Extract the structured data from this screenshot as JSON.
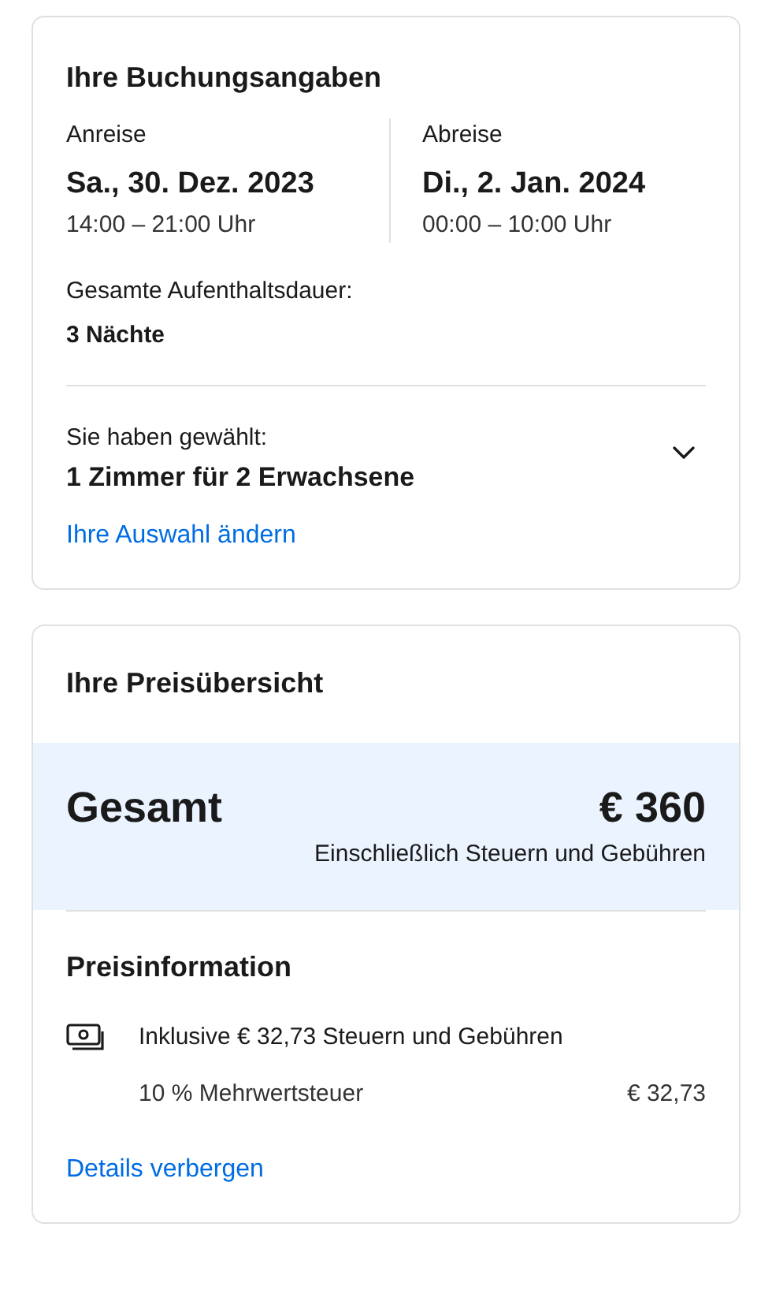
{
  "booking": {
    "title": "Ihre Buchungsangaben",
    "dates": [
      {
        "label": "Anreise",
        "date": "Sa., 30. Dez. 2023",
        "time": "14:00 – 21:00 Uhr"
      },
      {
        "label": "Abreise",
        "date": "Di., 2. Jan. 2024",
        "time": "00:00 – 10:00 Uhr"
      }
    ],
    "stay_label": "Gesamte Aufenthaltsdauer:",
    "stay_value": "3 Nächte",
    "selection_label": "Sie haben gewählt:",
    "selection_value": "1 Zimmer für 2 Erwachsene",
    "change_link": "Ihre Auswahl ändern"
  },
  "price": {
    "title": "Ihre Preisübersicht",
    "total_label": "Gesamt",
    "total_value": "€ 360",
    "total_note": "Einschließlich Steuern und Gebühren",
    "info_title": "Preisinformation",
    "included": "Inklusive € 32,73 Steuern und Gebühren",
    "items": [
      {
        "label": "10 % Mehrwertsteuer",
        "value": "€ 32,73"
      }
    ],
    "details_link": "Details verbergen"
  }
}
